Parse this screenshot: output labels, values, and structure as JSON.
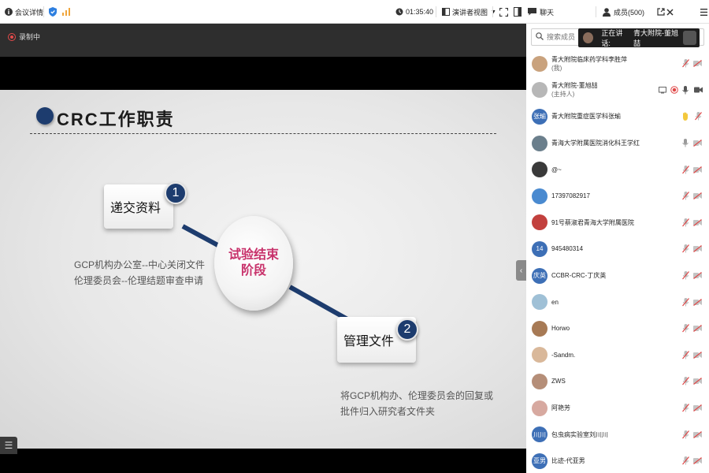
{
  "topbar": {
    "meeting_details_label": "会议详情",
    "timer": "01:35:40",
    "view_mode_label": "演讲者视图",
    "chat_label": "聊天",
    "members_label": "成员(500)"
  },
  "stage": {
    "recording_label": "录制中"
  },
  "slide": {
    "title": "CRC工作职责",
    "step1_num": "1",
    "step1_label": "递交资料",
    "step1_desc_line1": "GCP机构办公室--中心关闭文件",
    "step1_desc_line2": "伦理委员会--伦理结题审查申请",
    "center_line1": "试验结束",
    "center_line2": "阶段",
    "step2_num": "2",
    "step2_label": "管理文件",
    "step2_desc_line1": "将GCP机构办、伦理委员会的回复或",
    "step2_desc_line2": "批件归入研究者文件夹"
  },
  "panel": {
    "search_placeholder": "搜索成员",
    "speaking_label": "正在讲话:",
    "speaking_name": "青大附院-董旭喆"
  },
  "members": [
    {
      "name": "青大附院临床药学科李胜萍",
      "sub": "(我)",
      "avatar_text": "",
      "avatar_color": "#c9a27d",
      "mic": "muted",
      "cam": "off"
    },
    {
      "name": "青大附院-董旭喆",
      "sub": "(主持人)",
      "avatar_text": "",
      "avatar_color": "#b7b7b7",
      "mic": "on",
      "cam": "on"
    },
    {
      "name": "青大附院重症医学科张瑜",
      "sub": "",
      "avatar_text": "张瑜",
      "avatar_color": "#3d6fb6",
      "mic": "muted",
      "cam": "hand"
    },
    {
      "name": "青海大学附属医院消化科王学红",
      "sub": "",
      "avatar_text": "",
      "avatar_color": "#6b7f8c",
      "mic": "gray",
      "cam": "off"
    },
    {
      "name": "@~",
      "sub": "",
      "avatar_text": "",
      "avatar_color": "#3a3a3a",
      "mic": "muted",
      "cam": "off"
    },
    {
      "name": "17397082917",
      "sub": "",
      "avatar_text": "",
      "avatar_color": "#4a8ad0",
      "mic": "muted",
      "cam": "off"
    },
    {
      "name": "91号蔡淑君青海大学附属医院",
      "sub": "",
      "avatar_text": "",
      "avatar_color": "#c2403d",
      "mic": "muted",
      "cam": "off"
    },
    {
      "name": "945480314",
      "sub": "",
      "avatar_text": "14",
      "avatar_color": "#3d6fb6",
      "mic": "muted",
      "cam": "off"
    },
    {
      "name": "CCBR-CRC-丁庆英",
      "sub": "",
      "avatar_text": "庆英",
      "avatar_color": "#3d6fb6",
      "mic": "muted",
      "cam": "off"
    },
    {
      "name": "en",
      "sub": "",
      "avatar_text": "",
      "avatar_color": "#9fc0d6",
      "mic": "muted",
      "cam": "off"
    },
    {
      "name": "Horwo",
      "sub": "",
      "avatar_text": "",
      "avatar_color": "#a77a55",
      "mic": "muted",
      "cam": "off"
    },
    {
      "name": "-Sandm.",
      "sub": "",
      "avatar_text": "",
      "avatar_color": "#d9b89a",
      "mic": "muted",
      "cam": "off"
    },
    {
      "name": "ZWS",
      "sub": "",
      "avatar_text": "",
      "avatar_color": "#b58e78",
      "mic": "muted",
      "cam": "off"
    },
    {
      "name": "阿艳芳",
      "sub": "",
      "avatar_text": "",
      "avatar_color": "#d7a9a0",
      "mic": "muted",
      "cam": "off"
    },
    {
      "name": "包虫病实验室刘川川",
      "sub": "",
      "avatar_text": "川川",
      "avatar_color": "#3d6fb6",
      "mic": "muted",
      "cam": "off"
    },
    {
      "name": "比迹-代亚男",
      "sub": "",
      "avatar_text": "亚男",
      "avatar_color": "#3d6fb6",
      "mic": "muted",
      "cam": "off"
    }
  ]
}
